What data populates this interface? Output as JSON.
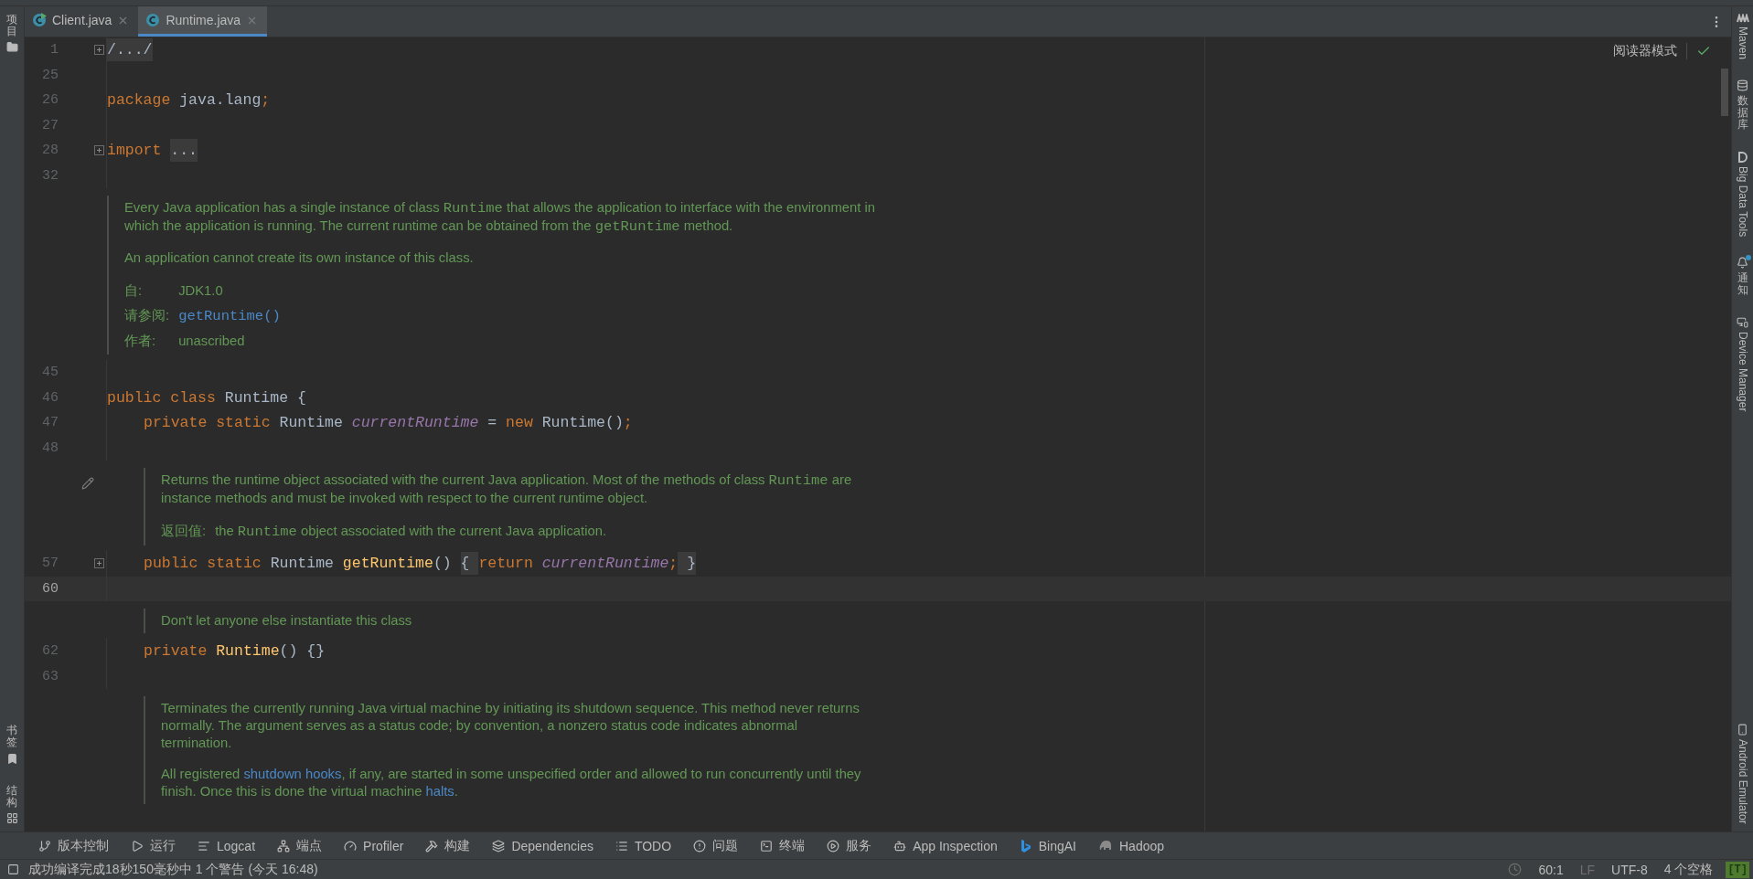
{
  "tabs": [
    {
      "label": "Client.java",
      "selected": false,
      "runnable": true
    },
    {
      "label": "Runtime.java",
      "selected": true,
      "runnable": false
    }
  ],
  "left_stripe": {
    "top": [
      {
        "label": "项目"
      }
    ],
    "bottom": [
      {
        "label": "书签"
      },
      {
        "label": "结构"
      }
    ]
  },
  "right_stripe": {
    "top": [
      {
        "label": "Maven",
        "latin": true,
        "notification": false
      },
      {
        "label": "数据库",
        "latin": false,
        "notification": false
      },
      {
        "label": "Big Data Tools",
        "latin": true,
        "notification": false
      },
      {
        "label": "通知",
        "latin": false,
        "notification": true
      },
      {
        "label": "Device Manager",
        "latin": true,
        "notification": false
      }
    ],
    "bottom": [
      {
        "label": "Android Emulator",
        "latin": true,
        "notification": false
      }
    ]
  },
  "reader_mode": "阅读器模式",
  "lines": [
    {
      "kind": "code",
      "number": "1",
      "folded": true,
      "current": false,
      "nested": false,
      "tokens": [
        {
          "kind": "folded",
          "text": "/.../"
        }
      ]
    },
    {
      "kind": "code",
      "number": "25",
      "folded": false,
      "current": false
    },
    {
      "kind": "code",
      "number": "26",
      "folded": false,
      "current": false,
      "nested": false,
      "tokens": [
        {
          "kind": "keyword",
          "text": "package"
        },
        {
          "kind": "plain",
          "text": " java.lang"
        },
        {
          "kind": "keyword",
          "text": ";"
        }
      ]
    },
    {
      "kind": "code",
      "number": "27",
      "folded": false,
      "current": false
    },
    {
      "kind": "code",
      "number": "28",
      "folded": true,
      "current": false,
      "nested": false,
      "tokens": [
        {
          "kind": "keyword",
          "text": "import "
        },
        {
          "kind": "folded",
          "text": "..."
        }
      ]
    },
    {
      "kind": "code",
      "number": "32",
      "folded": false,
      "current": false
    },
    {
      "kind": "doc",
      "nested": false,
      "hovered": false,
      "paragraphs": [
        [
          {
            "kind": "text",
            "text": "Every Java application has a single instance of class "
          },
          {
            "kind": "code",
            "text": "Runtime"
          },
          {
            "kind": "text",
            "text": " that allows the application to interface with the environment in which the application is running. The current runtime can be obtained from the "
          },
          {
            "kind": "code",
            "text": "getRuntime"
          },
          {
            "kind": "text",
            "text": " method."
          }
        ],
        [
          {
            "kind": "text",
            "text": "An application cannot create its own instance of this class."
          }
        ]
      ],
      "tags": [
        {
          "label": "自:",
          "value": [
            {
              "kind": "text",
              "text": "JDK1.0"
            }
          ]
        },
        {
          "label": "请参阅:",
          "value": [
            {
              "kind": "codelink",
              "text": "getRuntime()"
            }
          ]
        },
        {
          "label": "作者:",
          "value": [
            {
              "kind": "text",
              "text": "unascribed"
            }
          ]
        }
      ]
    },
    {
      "kind": "code",
      "number": "45",
      "folded": false,
      "current": false
    },
    {
      "kind": "code",
      "number": "46",
      "folded": false,
      "current": false,
      "nested": false,
      "tokens": [
        {
          "kind": "keyword",
          "text": "public class "
        },
        {
          "kind": "plain",
          "text": "Runtime {"
        }
      ]
    },
    {
      "kind": "code",
      "number": "47",
      "folded": false,
      "current": false,
      "nested": true,
      "tokens": [
        {
          "kind": "keyword",
          "text": "private static "
        },
        {
          "kind": "plain",
          "text": "Runtime "
        },
        {
          "kind": "field",
          "text": "currentRuntime"
        },
        {
          "kind": "plain",
          "text": " = "
        },
        {
          "kind": "keyword",
          "text": "new "
        },
        {
          "kind": "plain",
          "text": "Runtime()"
        },
        {
          "kind": "keyword",
          "text": ";"
        }
      ]
    },
    {
      "kind": "code",
      "number": "48",
      "folded": false,
      "current": false
    },
    {
      "kind": "doc",
      "nested": true,
      "hovered": true,
      "paragraphs": [
        [
          {
            "kind": "text",
            "text": "Returns the runtime object associated with the current Java application. Most of the methods of class "
          },
          {
            "kind": "code",
            "text": "Runtime"
          },
          {
            "kind": "text",
            "text": " are instance methods and must be invoked with respect to the current runtime object."
          }
        ]
      ],
      "tags": [
        {
          "label": "返回值:",
          "value": [
            {
              "kind": "text",
              "text": "the "
            },
            {
              "kind": "code",
              "text": "Runtime"
            },
            {
              "kind": "text",
              "text": " object associated with the current Java application."
            }
          ]
        }
      ]
    },
    {
      "kind": "code",
      "number": "57",
      "folded": true,
      "current": false,
      "nested": true,
      "tokens": [
        {
          "kind": "keyword",
          "text": "public static "
        },
        {
          "kind": "plain",
          "text": "Runtime "
        },
        {
          "kind": "method",
          "text": "getRuntime"
        },
        {
          "kind": "plain",
          "text": "() "
        },
        {
          "kind": "folded",
          "text": "{ "
        },
        {
          "kind": "keyword",
          "text": "return "
        },
        {
          "kind": "field",
          "text": "currentRuntime"
        },
        {
          "kind": "keyword",
          "text": ";"
        },
        {
          "kind": "folded",
          "text": " }"
        }
      ]
    },
    {
      "kind": "code",
      "number": "60",
      "folded": false,
      "current": true
    },
    {
      "kind": "doc",
      "nested": true,
      "hovered": false,
      "paragraphs": [
        [
          {
            "kind": "text",
            "text": "Don't let anyone else instantiate this class"
          }
        ]
      ]
    },
    {
      "kind": "code",
      "number": "62",
      "folded": false,
      "current": false,
      "nested": true,
      "tokens": [
        {
          "kind": "keyword",
          "text": "private "
        },
        {
          "kind": "method",
          "text": "Runtime"
        },
        {
          "kind": "plain",
          "text": "() {}"
        }
      ]
    },
    {
      "kind": "code",
      "number": "63",
      "folded": false,
      "current": false
    },
    {
      "kind": "doc",
      "nested": true,
      "hovered": false,
      "paragraphs": [
        [
          {
            "kind": "text",
            "text": "Terminates the currently running Java virtual machine by initiating its shutdown sequence. This method never returns normally. The argument serves as a status code; by convention, a nonzero status code indicates abnormal termination."
          }
        ],
        [
          {
            "kind": "text",
            "text": "All registered "
          },
          {
            "kind": "link",
            "text": "shutdown hooks"
          },
          {
            "kind": "text",
            "text": ", if any, are started in some unspecified order and allowed to run concurrently until they finish. Once this is done the virtual machine "
          },
          {
            "kind": "link",
            "text": "halts"
          },
          {
            "kind": "text",
            "text": "."
          }
        ]
      ]
    }
  ],
  "tool_windows": [
    {
      "label": "版本控制"
    },
    {
      "label": "运行"
    },
    {
      "label": "Logcat"
    },
    {
      "label": "端点"
    },
    {
      "label": "Profiler"
    },
    {
      "label": "构建"
    },
    {
      "label": "Dependencies"
    },
    {
      "label": "TODO"
    },
    {
      "label": "问题"
    },
    {
      "label": "终端"
    },
    {
      "label": "服务"
    },
    {
      "label": "App Inspection"
    },
    {
      "label": "BingAI"
    },
    {
      "label": "Hadoop"
    }
  ],
  "status": {
    "message": "成功编译完成18秒150毫秒中 1 个警告 (今天 16:48)",
    "position": "60:1",
    "line_separator": "LF",
    "encoding": "UTF-8",
    "indent": "4 个空格",
    "badge": "[T]"
  }
}
